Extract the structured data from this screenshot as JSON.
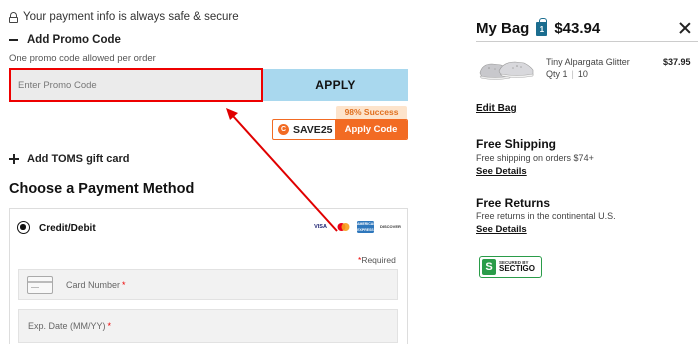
{
  "checkout": {
    "secure_text": "Your payment info is always safe & secure",
    "promo": {
      "heading": "Add Promo Code",
      "note": "One promo code allowed per order",
      "input_placeholder": "Enter Promo Code",
      "input_value": "",
      "apply_label": "APPLY"
    },
    "coupon_extension": {
      "success_rate": "98% Success",
      "logo_letter": "C",
      "code": "SAVE25",
      "apply_label": "Apply Code"
    },
    "gift_card_label": "Add TOMS gift card",
    "payment": {
      "title": "Choose a Payment Method",
      "method_label": "Credit/Debit",
      "card_brands": [
        "VISA",
        "mastercard",
        "AMERICAN EXPRESS",
        "DISCOVER"
      ],
      "required_note": "Required",
      "card_number_placeholder": "Card Number",
      "exp_date_placeholder": "Exp. Date (MM/YY)"
    }
  },
  "bag": {
    "title": "My Bag",
    "bag_count": "1",
    "total": "$43.94",
    "item": {
      "name": "Tiny Alpargata Glitter",
      "qty": "Qty 1",
      "size": "10",
      "price": "$37.95"
    },
    "edit_label": "Edit Bag",
    "shipping": {
      "title": "Free Shipping",
      "desc": "Free shipping on orders $74+",
      "link": "See Details"
    },
    "returns": {
      "title": "Free Returns",
      "desc": "Free returns in the continental U.S.",
      "link": "See Details"
    },
    "badge": {
      "letter": "S",
      "small_text": "SECURED BY",
      "brand": "SECTIGO"
    }
  },
  "colors": {
    "highlight_red": "#e00000",
    "apply_blue": "#a9d8ee",
    "coupon_orange": "#f26b23",
    "sectigo_green": "#2a9c49"
  }
}
